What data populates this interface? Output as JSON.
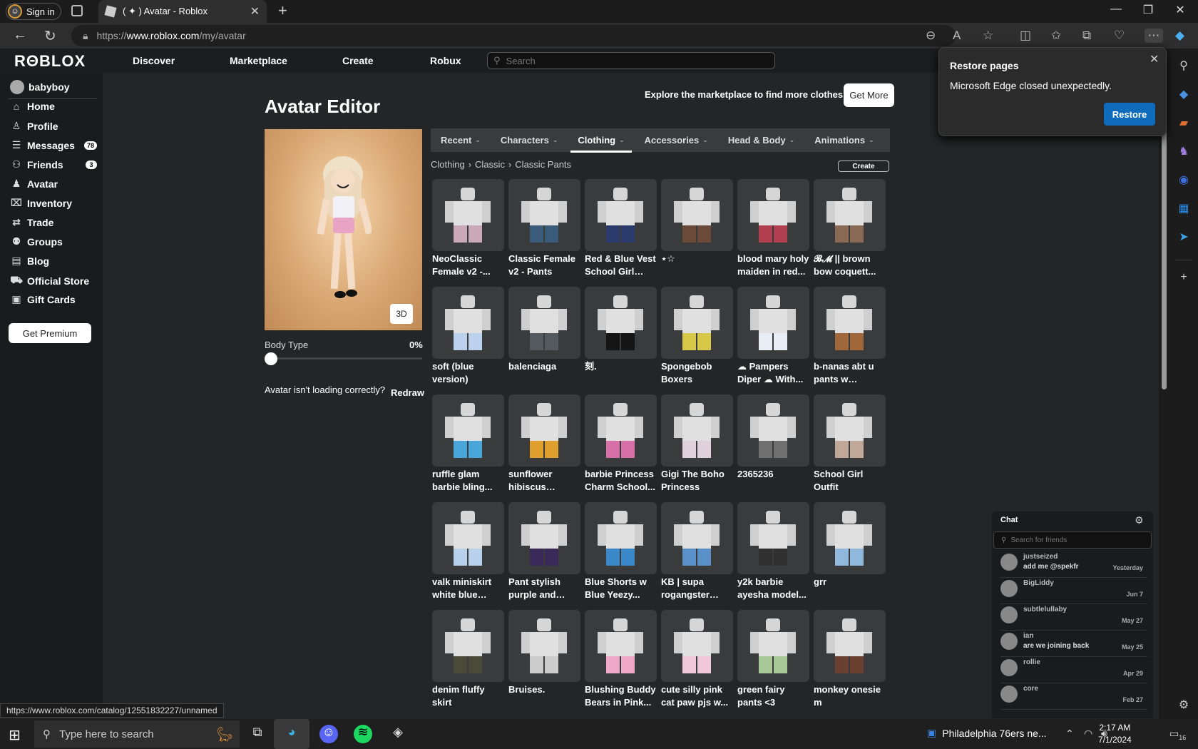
{
  "browser": {
    "signin": "Sign in",
    "tab_title": "( ✦ ) Avatar - Roblox",
    "url_prefix": "https://",
    "url_host": "www.roblox.com",
    "url_path": "/my/avatar",
    "status_url": "https://www.roblox.com/catalog/12551832227/unnamed"
  },
  "header": {
    "logo": "RΘBLOX",
    "nav": [
      "Discover",
      "Marketplace",
      "Create",
      "Robux"
    ],
    "search_placeholder": "Search"
  },
  "sidebar": {
    "username": "babyboy",
    "items": [
      {
        "label": "Home",
        "icon": "home-icon"
      },
      {
        "label": "Profile",
        "icon": "profile-icon"
      },
      {
        "label": "Messages",
        "icon": "messages-icon",
        "badge": "78"
      },
      {
        "label": "Friends",
        "icon": "friends-icon",
        "badge": "3"
      },
      {
        "label": "Avatar",
        "icon": "avatar-icon"
      },
      {
        "label": "Inventory",
        "icon": "inventory-icon"
      },
      {
        "label": "Trade",
        "icon": "trade-icon"
      },
      {
        "label": "Groups",
        "icon": "groups-icon"
      },
      {
        "label": "Blog",
        "icon": "blog-icon"
      },
      {
        "label": "Official Store",
        "icon": "store-icon"
      },
      {
        "label": "Gift Cards",
        "icon": "giftcard-icon"
      }
    ],
    "premium": "Get Premium"
  },
  "editor": {
    "title": "Avatar Editor",
    "explore": "Explore the marketplace to find more clothes!",
    "get_more": "Get More",
    "btn_3d": "3D",
    "body_type_label": "Body Type",
    "body_type_value": "0%",
    "body_type_fraction": 0,
    "not_loading": "Avatar isn't loading correctly?",
    "redraw": "Redraw",
    "tabs": [
      "Recent",
      "Characters",
      "Clothing",
      "Accessories",
      "Head & Body",
      "Animations"
    ],
    "active_tab": "Clothing",
    "breadcrumb": [
      "Clothing",
      "Classic",
      "Classic Pants"
    ],
    "create": "Create",
    "items": [
      {
        "name": "NeoClassic Female v2 -...",
        "color": "#c9a9b8"
      },
      {
        "name": "Classic Female v2 - Pants",
        "color": "#3b5b7a"
      },
      {
        "name": "Red & Blue Vest School Girl Out...",
        "color": "#2a3a6a"
      },
      {
        "name": "⋆☆",
        "color": "#6b4a3a"
      },
      {
        "name": "blood mary holy maiden in red...",
        "color": "#b04050"
      },
      {
        "name": "𝓑𝓜 || brown bow coquett...",
        "color": "#8a6a55"
      },
      {
        "name": "soft (blue version)",
        "color": "#bcd2ec"
      },
      {
        "name": "balenciaga",
        "color": "#555a60"
      },
      {
        "name": "刻.",
        "color": "#151515"
      },
      {
        "name": "Spongebob Boxers",
        "color": "#d8c84a"
      },
      {
        "name": "☁ Pampers Diper ☁ With...",
        "color": "#e8eef5"
      },
      {
        "name": "b-nanas abt u pants w yellaur...",
        "color": "#a0683a"
      },
      {
        "name": "ruffle glam barbie bling...",
        "color": "#4aa6d8"
      },
      {
        "name": "sunflower hibiscus tropica...",
        "color": "#e0a030"
      },
      {
        "name": "barbie Princess Charm School...",
        "color": "#d870a8"
      },
      {
        "name": "Gigi The Boho Princess",
        "color": "#e0d0dc"
      },
      {
        "name": "2365236",
        "color": "#707070"
      },
      {
        "name": "School Girl Outfit",
        "color": "#c0a898"
      },
      {
        "name": "valk miniskirt white blue doll...",
        "color": "#b8d0ea"
      },
      {
        "name": "Pant stylish purple and blue...",
        "color": "#3a2a5a"
      },
      {
        "name": "Blue Shorts w Blue Yeezy...",
        "color": "#3a88c8"
      },
      {
        "name": "KB | supa rogangster Blu...",
        "color": "#5a90c8"
      },
      {
        "name": "y2k barbie ayesha model...",
        "color": "#303030"
      },
      {
        "name": "grr",
        "color": "#90b8dc"
      },
      {
        "name": "denim fluffy skirt",
        "color": "#4a4a3a"
      },
      {
        "name": "Bruises.",
        "color": "#cccccc"
      },
      {
        "name": "Blushing Buddy Bears in Pink...",
        "color": "#f0a8c8"
      },
      {
        "name": "cute silly pink cat paw pjs w...",
        "color": "#f0c8d8"
      },
      {
        "name": "green fairy pants <3",
        "color": "#a8c898"
      },
      {
        "name": "monkey onesie m",
        "color": "#6a4030"
      }
    ]
  },
  "restore_popup": {
    "title": "Restore pages",
    "message": "Microsoft Edge closed unexpectedly.",
    "button": "Restore"
  },
  "chat": {
    "title": "Chat",
    "search_placeholder": "Search for friends",
    "conversations": [
      {
        "name": "justseized",
        "message": "add me @spekfr",
        "date": "Yesterday"
      },
      {
        "name": "BigLiddy",
        "message": "",
        "date": "Jun 7"
      },
      {
        "name": "subtlelullaby",
        "message": "",
        "date": "May 27"
      },
      {
        "name": "ian",
        "message": "are we joining back",
        "date": "May 25"
      },
      {
        "name": "rollie",
        "message": "",
        "date": "Apr 29"
      },
      {
        "name": "core",
        "message": "",
        "date": "Feb 27"
      }
    ]
  },
  "taskbar": {
    "search_placeholder": "Type here to search",
    "weather": "Philadelphia 76ers ne...",
    "time": "2:17 AM",
    "date": "7/1/2024",
    "notif_count": "16"
  }
}
